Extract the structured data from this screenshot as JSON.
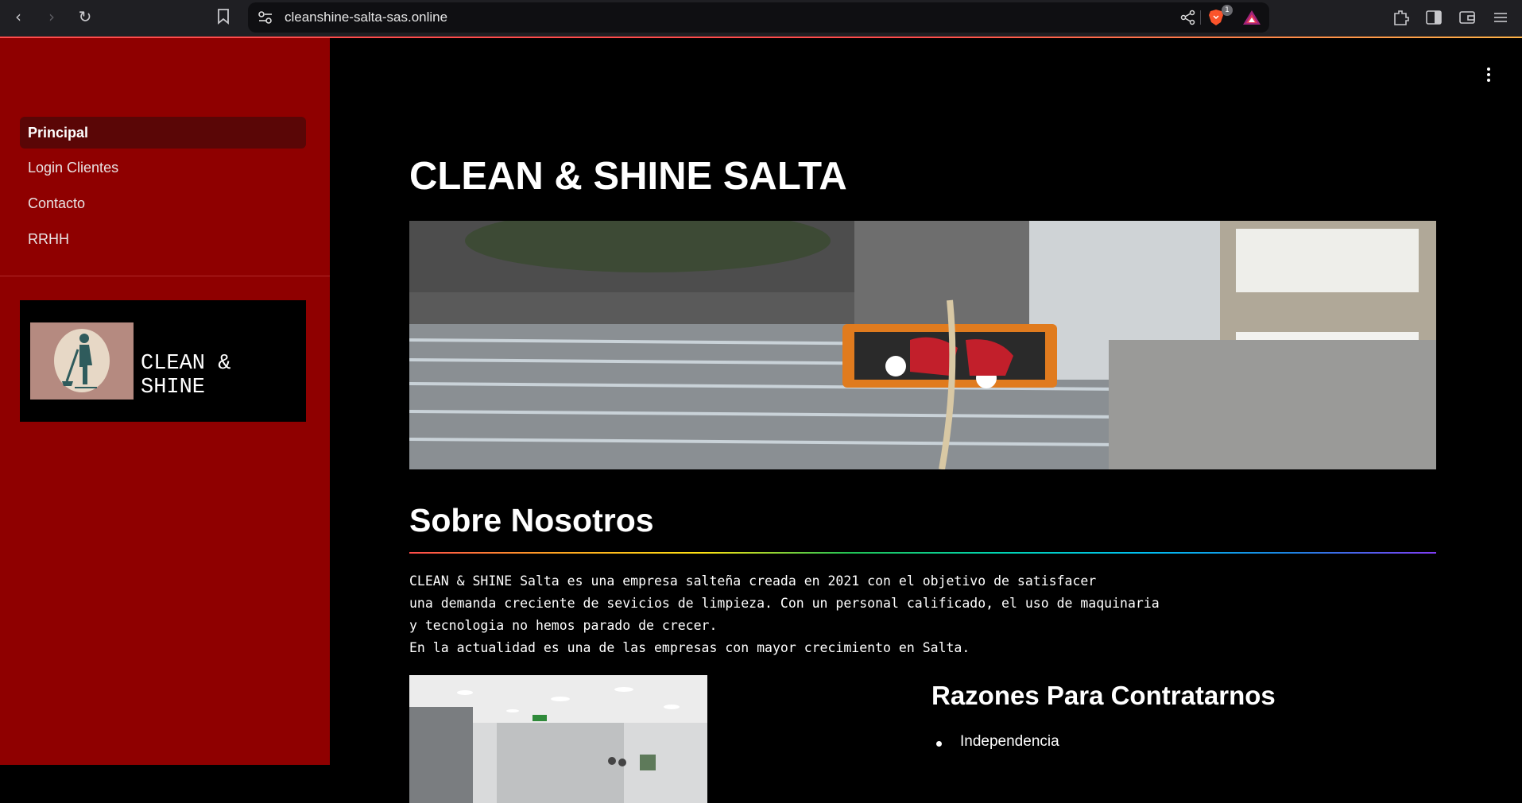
{
  "browser": {
    "url": "cleanshine-salta-sas.online",
    "shields_badge": "1"
  },
  "sidebar": {
    "items": [
      {
        "label": "Principal",
        "active": true
      },
      {
        "label": "Login Clientes",
        "active": false
      },
      {
        "label": "Contacto",
        "active": false
      },
      {
        "label": "RRHH",
        "active": false
      }
    ],
    "logo_text": "CLEAN & SHINE"
  },
  "main": {
    "title": "CLEAN & SHINE SALTA",
    "about_heading": "Sobre Nosotros",
    "about_lines": [
      "CLEAN & SHINE Salta es una empresa salteña creada en 2021 con el objetivo de satisfacer",
      "una demanda creciente de sevicios de limpieza. Con un personal calificado, el uso de maquinaria",
      "y tecnologia no hemos parado de crecer.",
      "En la actualidad es una de las empresas con mayor crecimiento en Salta."
    ],
    "reasons_heading": "Razones Para Contratarnos",
    "reasons": [
      "Independencia"
    ]
  },
  "colors": {
    "sidebar_bg": "#8f0000",
    "sidebar_active": "#5a0606",
    "main_bg": "#000000"
  }
}
